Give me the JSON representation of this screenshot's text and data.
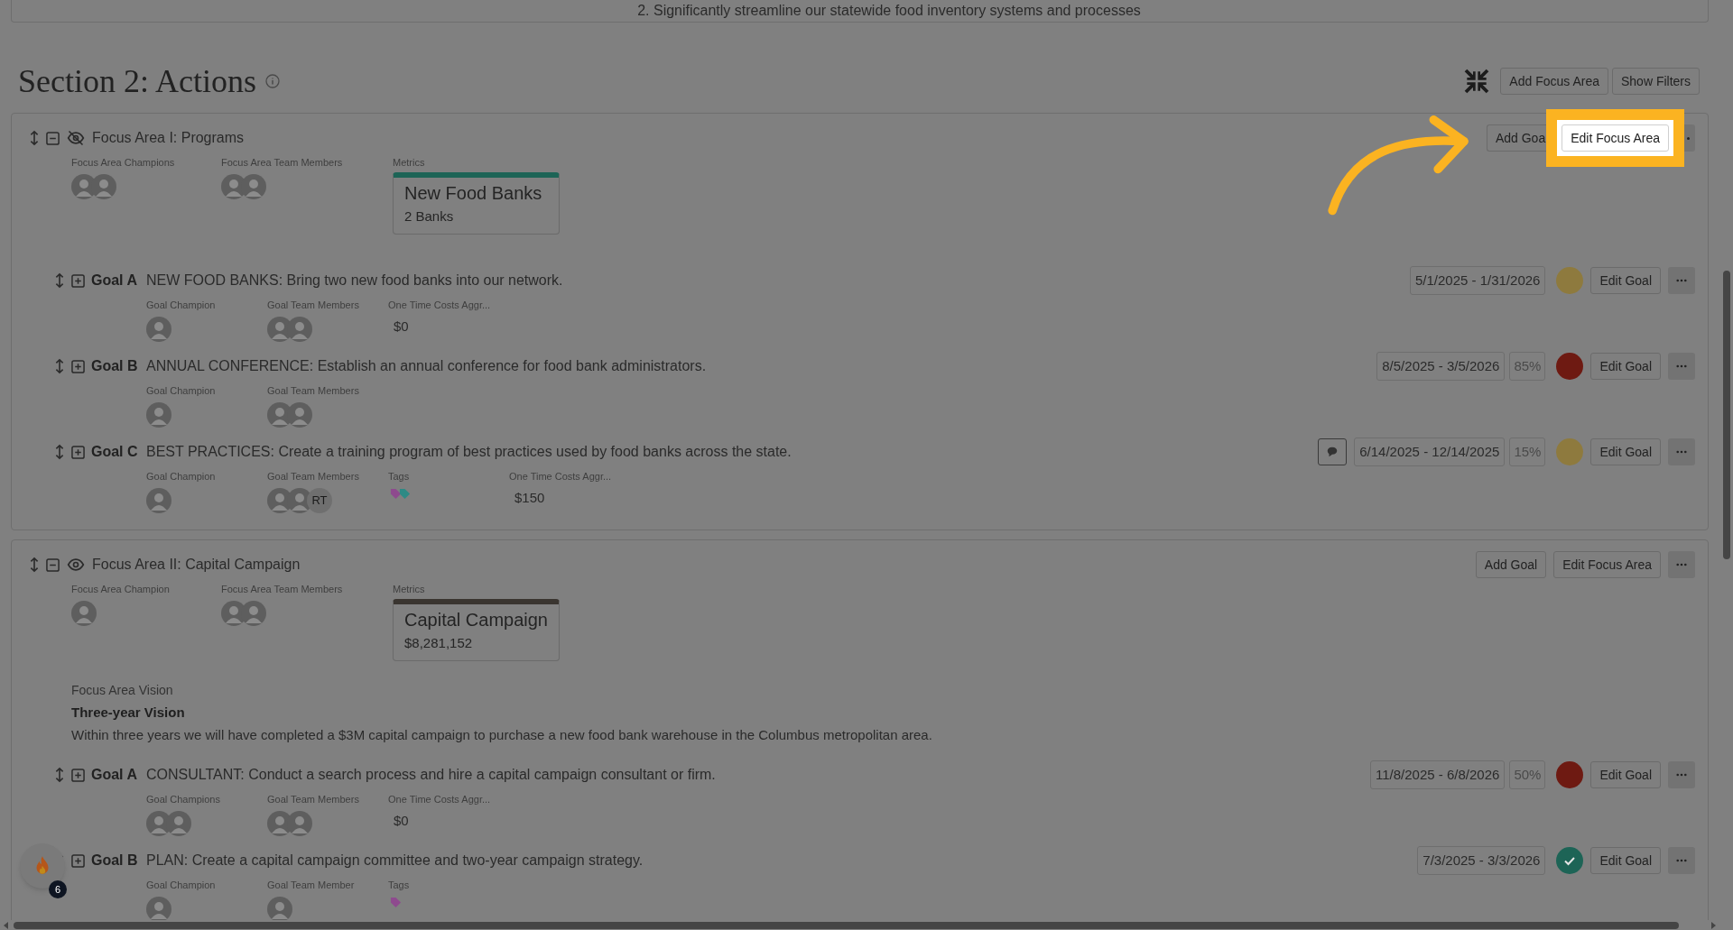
{
  "top_card": {
    "text": "2. Significantly streamline our statewide food inventory systems and processes"
  },
  "section": {
    "title": "Section 2: Actions",
    "buttons": [
      "Add Focus Area",
      "Show Filters"
    ]
  },
  "focus_areas": [
    {
      "title": "Focus Area I: Programs",
      "visible": false,
      "expanded": true,
      "buttons": [
        {
          "label": "Add Goa",
          "highlighted": false
        },
        {
          "label": "Edit Focus Area",
          "highlighted": true
        }
      ],
      "fields": [
        {
          "label": "Focus Area Champions",
          "avatars": [
            {
              "kind": "photo"
            },
            {
              "kind": "photo"
            }
          ]
        },
        {
          "label": "Focus Area Team Members",
          "avatars": [
            {
              "kind": "photo"
            },
            {
              "kind": "photo"
            }
          ]
        }
      ],
      "metric": {
        "label": "Metrics",
        "title": "New Food Banks",
        "value": "2 Banks",
        "color": "#1d6456"
      },
      "goals": [
        {
          "label": "Goal A",
          "text": "NEW FOOD BANKS: Bring two new food banks into our network.",
          "dates": "5/1/2025 - 1/31/2026",
          "status": {
            "color": "#8e7a3e",
            "checked": false
          },
          "button": "Edit Goal",
          "fields": [
            {
              "kind": "avatars",
              "label": "Goal Champion",
              "avatars": [
                {
                  "kind": "photo"
                }
              ]
            },
            {
              "kind": "avatars",
              "label": "Goal Team Members",
              "avatars": [
                {
                  "kind": "photo"
                },
                {
                  "kind": "photo"
                }
              ]
            },
            {
              "kind": "value",
              "label": "One Time Costs Aggr...",
              "value": "$0"
            }
          ]
        },
        {
          "label": "Goal B",
          "text": "ANNUAL CONFERENCE: Establish an annual conference for food bank administrators.",
          "dates": "8/5/2025 - 3/5/2026",
          "percent": "85%",
          "status": {
            "color": "#6e1a12",
            "checked": false
          },
          "button": "Edit Goal",
          "fields": [
            {
              "kind": "avatars",
              "label": "Goal Champion",
              "avatars": [
                {
                  "kind": "photo"
                }
              ]
            },
            {
              "kind": "avatars",
              "label": "Goal Team Members",
              "avatars": [
                {
                  "kind": "photo"
                },
                {
                  "kind": "photo"
                }
              ]
            }
          ]
        },
        {
          "label": "Goal C",
          "text": "BEST PRACTICES: Create a training program of best practices used by food banks across the state.",
          "dates": "6/14/2025 - 12/14/2025",
          "percent": "15%",
          "comment": true,
          "status": {
            "color": "#8e7a3e",
            "checked": false
          },
          "button": "Edit Goal",
          "fields": [
            {
              "kind": "avatars",
              "label": "Goal Champion",
              "avatars": [
                {
                  "kind": "photo"
                }
              ]
            },
            {
              "kind": "avatars",
              "label": "Goal Team Members",
              "avatars": [
                {
                  "kind": "photo"
                },
                {
                  "kind": "photo"
                },
                {
                  "kind": "initials",
                  "text": "RT"
                }
              ]
            },
            {
              "kind": "tags",
              "label": "Tags",
              "tags": [
                {
                  "color": "#8e4a8e"
                },
                {
                  "color": "#2e8a85"
                }
              ]
            },
            {
              "kind": "value",
              "label": "One Time Costs Aggr...",
              "value": "$150"
            }
          ]
        }
      ]
    },
    {
      "title": "Focus Area II: Capital Campaign",
      "visible": true,
      "expanded": true,
      "buttons": [
        {
          "label": "Add Goal",
          "highlighted": false
        },
        {
          "label": "Edit Focus Area",
          "highlighted": false
        }
      ],
      "fields": [
        {
          "label": "Focus Area Champion",
          "avatars": [
            {
              "kind": "photo"
            }
          ]
        },
        {
          "label": "Focus Area Team Members",
          "avatars": [
            {
              "kind": "photo"
            },
            {
              "kind": "photo"
            }
          ]
        }
      ],
      "metric": {
        "label": "Metrics",
        "title": "Capital Campaign",
        "value": "$8,281,152",
        "color": "#3a3530"
      },
      "vision": {
        "label": "Focus Area Vision",
        "title": "Three-year Vision",
        "text": "Within three years we will have completed a $3M capital campaign to purchase a new food bank warehouse in the Columbus metropolitan area."
      },
      "goals": [
        {
          "label": "Goal A",
          "text": "CONSULTANT: Conduct a search process and hire a capital campaign consultant or firm.",
          "dates": "11/8/2025 - 6/8/2026",
          "percent": "50%",
          "status": {
            "color": "#6e1a12",
            "checked": false
          },
          "button": "Edit Goal",
          "fields": [
            {
              "kind": "avatars",
              "label": "Goal Champions",
              "avatars": [
                {
                  "kind": "photo"
                },
                {
                  "kind": "photo"
                }
              ]
            },
            {
              "kind": "avatars",
              "label": "Goal Team Members",
              "avatars": [
                {
                  "kind": "photo"
                },
                {
                  "kind": "photo"
                }
              ]
            },
            {
              "kind": "value",
              "label": "One Time Costs Aggr...",
              "value": "$0"
            }
          ]
        },
        {
          "label": "Goal B",
          "text": "PLAN: Create a capital campaign committee and two-year campaign strategy.",
          "dates": "7/3/2025 - 3/3/2026",
          "status": {
            "color": "#1d6456",
            "checked": true
          },
          "button": "Edit Goal",
          "fields": [
            {
              "kind": "avatars",
              "label": "Goal Champion",
              "avatars": [
                {
                  "kind": "photo"
                }
              ]
            },
            {
              "kind": "avatars",
              "label": "Goal Team Member",
              "avatars": [
                {
                  "kind": "photo"
                }
              ]
            },
            {
              "kind": "tags",
              "label": "Tags",
              "tags": [
                {
                  "color": "#8e4a8e"
                }
              ]
            }
          ]
        }
      ]
    }
  ],
  "notification": {
    "count": "6"
  }
}
